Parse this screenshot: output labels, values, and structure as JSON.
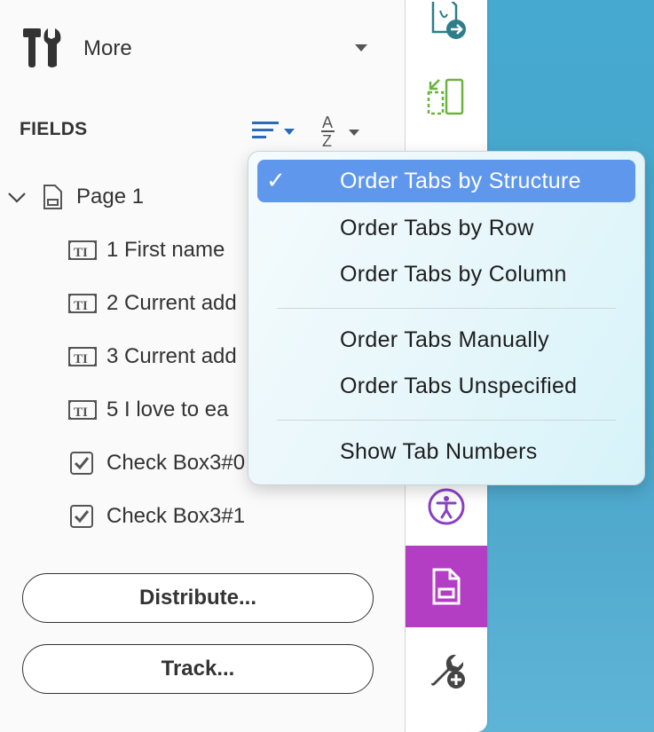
{
  "toolbar": {
    "more_label": "More"
  },
  "fields": {
    "title": "FIELDS"
  },
  "tree": {
    "page_label": "Page 1",
    "items": [
      {
        "label": "1 First name",
        "type": "text"
      },
      {
        "label": "2 Current add",
        "type": "text"
      },
      {
        "label": "3 Current add",
        "type": "text"
      },
      {
        "label": "5 I love to ea",
        "type": "text"
      },
      {
        "label": "Check Box3#0",
        "type": "checkbox"
      },
      {
        "label": "Check Box3#1",
        "type": "checkbox"
      }
    ]
  },
  "buttons": {
    "distribute": "Distribute...",
    "track": "Track..."
  },
  "menu": {
    "items": [
      {
        "label": "Order Tabs by Structure",
        "checked": true
      },
      {
        "label": "Order Tabs by Row",
        "checked": false
      },
      {
        "label": "Order Tabs by Column",
        "checked": false
      },
      {
        "label": "Order Tabs Manually",
        "checked": false
      },
      {
        "label": "Order Tabs Unspecified",
        "checked": false
      },
      {
        "label": "Show Tab Numbers",
        "checked": false
      }
    ],
    "check_glyph": "✓"
  },
  "rail": {
    "icons": [
      "export-pdf-icon",
      "organize-pages-icon",
      "accessibility-icon",
      "prepare-form-icon",
      "add-tools-icon"
    ],
    "active": "prepare-form-icon"
  },
  "colors": {
    "accent_selected": "#5e97ec",
    "rail_active": "#b33ec4",
    "sort_icon": "#2a6bb8",
    "background": "#4aa6cb"
  }
}
